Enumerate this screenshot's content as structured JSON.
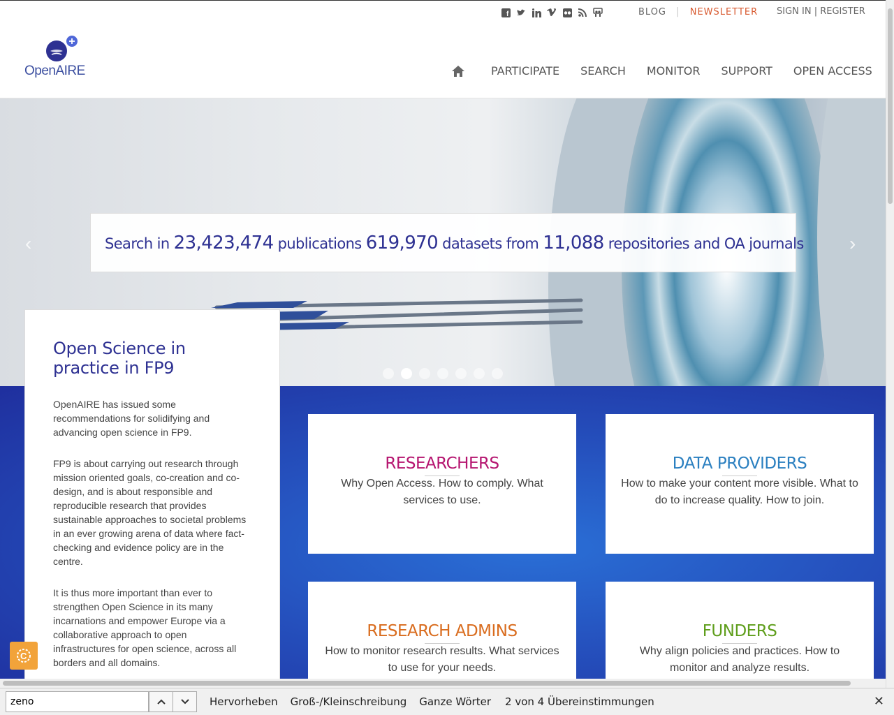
{
  "header": {
    "social_icons": [
      "facebook-icon",
      "twitter-icon",
      "linkedin-icon",
      "vimeo-icon",
      "flickr-icon",
      "rss-icon",
      "slideshare-icon"
    ],
    "blog_label": "BLOG",
    "newsletter_label": "NEWSLETTER",
    "signin_label": "SIGN IN | REGISTER",
    "logo_text": "OpenAIRE",
    "nav": [
      "PARTICIPATE",
      "SEARCH",
      "MONITOR",
      "SUPPORT",
      "OPEN ACCESS"
    ]
  },
  "hero": {
    "search_prefix": "Search in",
    "publications_count": "23,423,474",
    "publications_label": "publications",
    "datasets_count": "619,970",
    "datasets_label": "datasets from",
    "repositories_count": "11,088",
    "repositories_label": "repositories and OA journals",
    "slide_count": 7,
    "active_slide": 2
  },
  "info_card": {
    "title": "Open Science in practice in FP9",
    "paragraphs": [
      "OpenAIRE has issued some recommendations for solidifying and advancing open science in FP9.",
      "FP9 is about carrying out research through mission oriented goals, co-creation and co-design, and is about responsible and reproducible research that provides sustainable approaches to societal problems in an ever growing arena of data where fact-checking and evidence policy are in the centre.",
      "It is thus more important than ever to strengthen Open Science in its many incarnations and empower Europe via a collaborative approach to open infrastructures for open science, across all borders and all domains."
    ]
  },
  "cards": [
    {
      "title": "RESEARCHERS",
      "text": "Why Open Access. How to comply. What services to use.",
      "color": "#b5146f"
    },
    {
      "title": "DATA PROVIDERS",
      "text": "How to make your content more visible. What to do to increase quality. How to join.",
      "color": "#2a7fc0"
    },
    {
      "title": "RESEARCH ADMINS",
      "text": "How to monitor research results. What services to use for your needs.",
      "color": "#d96c1e"
    },
    {
      "title": "FUNDERS",
      "text": "Why align policies and practices. How to monitor and analyze results.",
      "color": "#5f9e1c"
    }
  ],
  "colors": {
    "brand_navy": "#2e3192",
    "newsletter": "#d85a30",
    "cookie": "#f2a33a"
  },
  "findbar": {
    "query": "zeno",
    "highlight_label": "Hervorheben",
    "case_label": "Groß-/Kleinschreibung",
    "whole_words_label": "Ganze Wörter",
    "status": "2 von 4 Übereinstimmungen"
  }
}
